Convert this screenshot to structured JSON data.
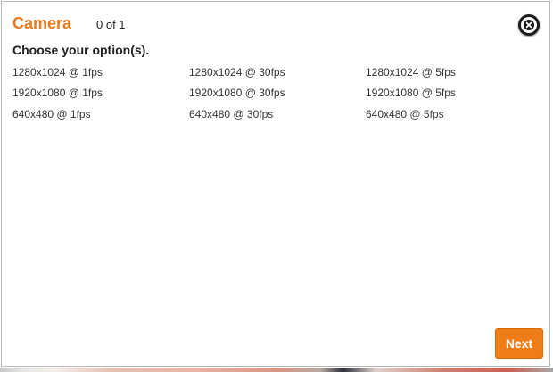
{
  "dialog": {
    "title": "Camera",
    "progress": "0 of 1",
    "prompt": "Choose your option(s).",
    "next_label": "Next",
    "close_icon": "close-circle-icon"
  },
  "options": [
    {
      "label": "1280x1024 @ 1fps"
    },
    {
      "label": "1280x1024 @ 30fps"
    },
    {
      "label": "1280x1024 @ 5fps"
    },
    {
      "label": "1920x1080 @ 1fps"
    },
    {
      "label": "1920x1080 @ 30fps"
    },
    {
      "label": "1920x1080 @ 5fps"
    },
    {
      "label": "640x480 @ 1fps"
    },
    {
      "label": "640x480 @ 30fps"
    },
    {
      "label": "640x480 @ 5fps"
    }
  ],
  "colors": {
    "accent": "#e87a1e",
    "button": "#ee7d18"
  }
}
